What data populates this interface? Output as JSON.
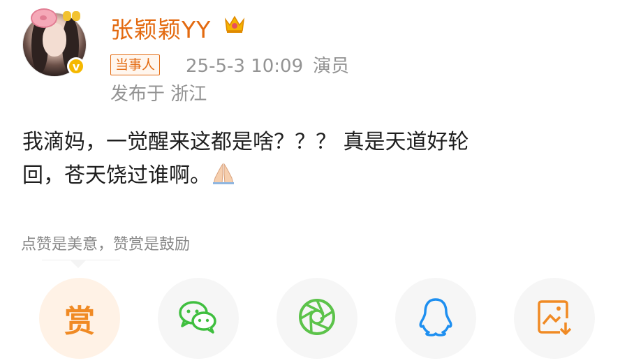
{
  "user": {
    "name": "张颖颖YY",
    "badge": "当事人",
    "timestamp": "25-5-3 10:09",
    "role": "演员",
    "location": "发布于 浙江",
    "verified_mark": "v"
  },
  "post": {
    "line1": "我滴妈，一觉醒来这都是啥？？？ 真是天道好轮",
    "line2": "回，苍天饶过谁啊。"
  },
  "reward": {
    "tip": "点赞是美意，赞赏是鼓励",
    "button_label": "赏"
  },
  "share_buttons": [
    "reward-button",
    "wechat-share-button",
    "moments-share-button",
    "qq-share-button",
    "save-image-button"
  ],
  "colors": {
    "accent": "#e36a10",
    "wechat": "#3fbf3f",
    "moments": "#5cc34a",
    "qq": "#1e8ff0",
    "save": "#f08a24"
  }
}
